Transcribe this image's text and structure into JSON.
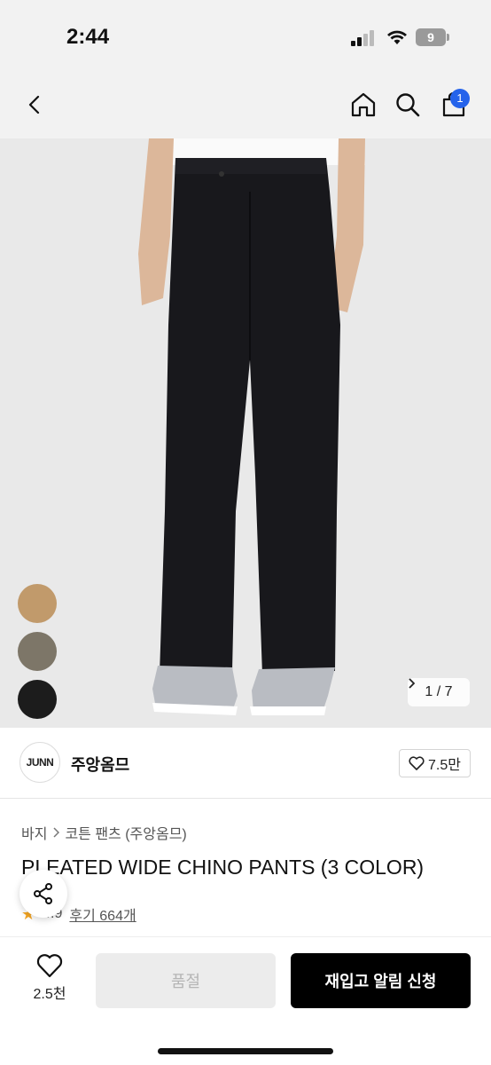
{
  "status_bar": {
    "time": "2:44",
    "battery_level": "9"
  },
  "nav": {
    "back_icon": "chevron-left-icon",
    "home_icon": "home-icon",
    "search_icon": "search-icon",
    "cart_icon": "bag-icon",
    "cart_count": "1"
  },
  "gallery": {
    "counter": "1 / 7",
    "swatches": [
      {
        "color": "#c19a6b"
      },
      {
        "color": "#7d7668"
      },
      {
        "color": "#1c1c1c"
      }
    ]
  },
  "brand": {
    "logo_text": "JUNN",
    "name": "주앙옴므",
    "likes": "7.5만"
  },
  "product": {
    "breadcrumb": [
      "바지",
      "코튼 팬츠 (주앙옴므)"
    ],
    "title": "PLEATED WIDE CHINO PANTS (3 COLOR)",
    "rating": "4.9",
    "reviews": "후기 664개"
  },
  "bottom": {
    "like_count": "2.5천",
    "soldout_label": "품절",
    "restock_label": "재입고 알림 신청"
  },
  "colors": {
    "accent": "#2563eb",
    "star": "#f5a623",
    "primary_button": "#000000"
  }
}
